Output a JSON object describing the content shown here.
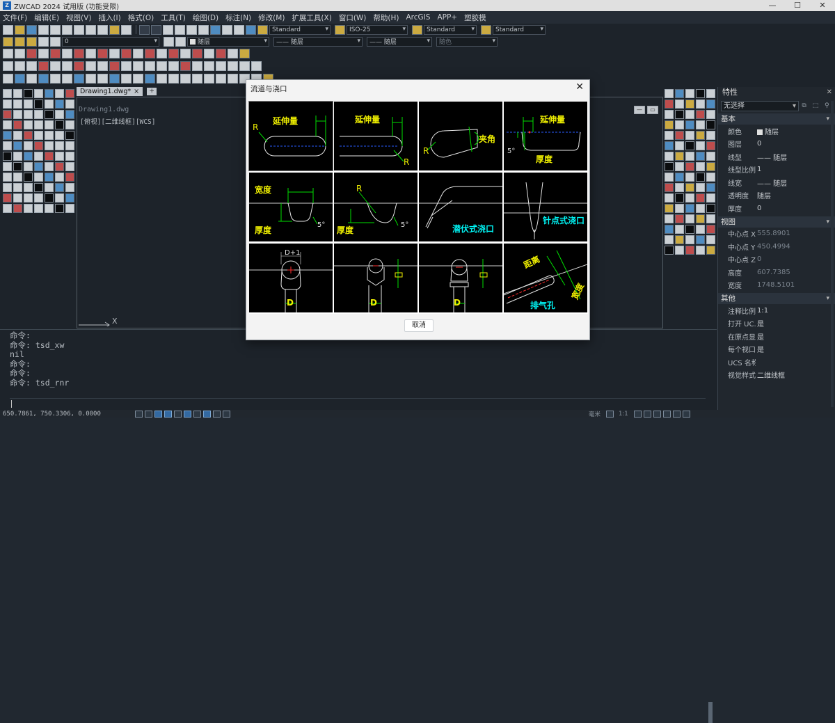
{
  "app": {
    "title": "ZWCAD 2024 试用版 (功能受限)",
    "icon": "zw-app-icon",
    "window_buttons": [
      "—",
      "☐",
      "✕"
    ]
  },
  "menu": [
    "文件(F)",
    "编辑(E)",
    "视图(V)",
    "插入(I)",
    "格式(O)",
    "工具(T)",
    "绘图(D)",
    "标注(N)",
    "修改(M)",
    "扩展工具(X)",
    "窗口(W)",
    "帮助(H)",
    "ArcGIS",
    "APP+",
    "塑胶模"
  ],
  "toolbar": {
    "text_style": "Standard",
    "dim_style": "ISO-25",
    "table_style": "Standard",
    "multileader_style": "Standard",
    "layer": "0",
    "color": "随层",
    "linetype": "—— 随层",
    "lineweight": "—— 随层",
    "plot_style": "随色"
  },
  "tabs": {
    "drawing_tab": "Drawing1.dwg*",
    "close_glyph": "×",
    "new_tab_glyph": "+"
  },
  "viewport": {
    "window_title": "Drawing1.dwg",
    "label": "[俯视][二维线框][WCS]",
    "ucs_x": "X"
  },
  "command": {
    "history": [
      "命令:",
      "命令: tsd_xw",
      "nil",
      "命令:",
      "命令:",
      "命令: tsd_rnr"
    ],
    "input": ""
  },
  "statusbar": {
    "coords": "650.7861, 750.3306, 0.0000",
    "scale": "1:1",
    "unit": "毫米"
  },
  "properties": {
    "title": "特性",
    "selection": "无选择",
    "sections": [
      {
        "name": "基本",
        "rows": [
          {
            "key": "颜色",
            "value": "随层",
            "swatch": true
          },
          {
            "key": "图层",
            "value": "0"
          },
          {
            "key": "线型",
            "value": "—— 随层"
          },
          {
            "key": "线型比例",
            "value": "1"
          },
          {
            "key": "线宽",
            "value": "—— 随层"
          },
          {
            "key": "透明度",
            "value": "随层"
          },
          {
            "key": "厚度",
            "value": "0"
          }
        ]
      },
      {
        "name": "视图",
        "rows": [
          {
            "key": "中心点 X",
            "value": "555.8901",
            "dim": true
          },
          {
            "key": "中心点 Y",
            "value": "450.4994",
            "dim": true
          },
          {
            "key": "中心点 Z",
            "value": "0",
            "dim": true
          },
          {
            "key": "高度",
            "value": "607.7385",
            "dim": true
          },
          {
            "key": "宽度",
            "value": "1748.5101",
            "dim": true
          }
        ]
      },
      {
        "name": "其他",
        "rows": [
          {
            "key": "注释比例",
            "value": "1:1"
          },
          {
            "key": "打开 UC...",
            "value": "是"
          },
          {
            "key": "在原点显...",
            "value": "是"
          },
          {
            "key": "每个视口...",
            "value": "是"
          },
          {
            "key": "UCS 名称",
            "value": ""
          },
          {
            "key": "视觉样式",
            "value": "二维线框"
          }
        ]
      }
    ]
  },
  "dialog": {
    "title": "流道与浇口",
    "close": "✕",
    "cancel": "取消",
    "cells": [
      {
        "labels": [
          "延伸量",
          "R"
        ]
      },
      {
        "labels": [
          "延伸量",
          "R"
        ]
      },
      {
        "labels": [
          "夹角",
          "R"
        ]
      },
      {
        "labels": [
          "延伸量",
          "厚度",
          "5°"
        ]
      },
      {
        "labels": [
          "宽度",
          "厚度",
          "5°"
        ]
      },
      {
        "labels": [
          "厚度",
          "R",
          "5°"
        ]
      },
      {
        "labels": [
          "潜伏式浇口"
        ]
      },
      {
        "labels": [
          "针点式浇口"
        ]
      },
      {
        "labels": [
          "D+1",
          "D"
        ]
      },
      {
        "labels": [
          "D"
        ]
      },
      {
        "labels": [
          "D"
        ]
      },
      {
        "labels": [
          "距离",
          "宽度",
          "排气孔"
        ]
      }
    ]
  },
  "colors": {
    "background": "#212830",
    "dialog_bg": "#f3f3f3",
    "label_yellow": "#f0f000",
    "label_cyan": "#00f5f5",
    "accent": "#1d6fd1"
  }
}
